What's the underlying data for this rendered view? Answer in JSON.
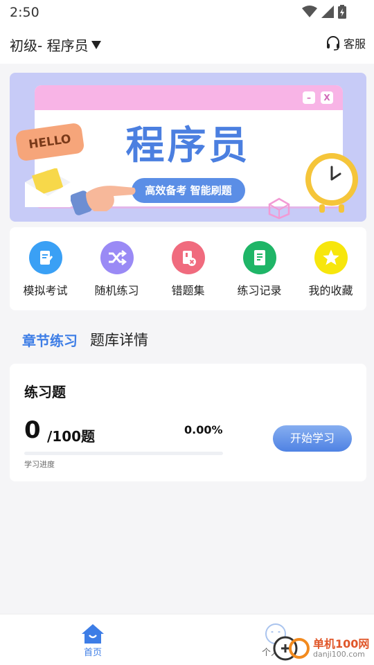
{
  "status": {
    "time": "2:50"
  },
  "header": {
    "title": "初级- 程序员",
    "service_label": "客服"
  },
  "banner": {
    "hello": "HELLO",
    "headline": "程序员",
    "slogan": "高效备考 智能刷题",
    "minimize": "–",
    "close": "X"
  },
  "quick_actions": [
    {
      "label": "模拟考试",
      "icon": "exam-icon",
      "color": "#3aa0f5"
    },
    {
      "label": "随机练习",
      "icon": "shuffle-icon",
      "color": "#9a8af5"
    },
    {
      "label": "错题集",
      "icon": "wrong-book-icon",
      "color": "#f06b7e"
    },
    {
      "label": "练习记录",
      "icon": "record-icon",
      "color": "#1fb567"
    },
    {
      "label": "我的收藏",
      "icon": "star-icon",
      "color": "#f7e60c"
    }
  ],
  "tabs": {
    "active": "章节练习",
    "other": "题库详情"
  },
  "practice": {
    "heading": "练习题",
    "done": "0",
    "total": "/100题",
    "percent": "0.00%",
    "progress": 0,
    "progress_label": "学习进度",
    "start_label": "开始学习"
  },
  "bottom_nav": {
    "home": "首页",
    "me": "个人中"
  },
  "watermark": {
    "name": "单机100网",
    "url": "danji100.com"
  },
  "colors": {
    "accent": "#3d7de6",
    "button": "#5b8ee6"
  }
}
